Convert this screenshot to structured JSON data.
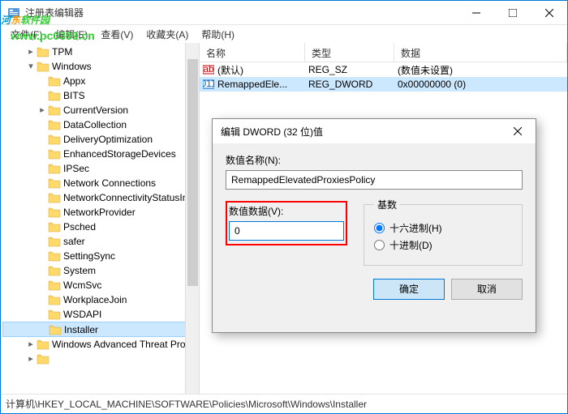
{
  "window": {
    "title": "注册表编辑器"
  },
  "menu": {
    "file": "文件(F)",
    "edit": "编辑(E)",
    "view": "查看(V)",
    "favorites": "收藏夹(A)",
    "help": "帮助(H)"
  },
  "tree": {
    "items": [
      {
        "indent": 2,
        "expand": ">",
        "label": "TPM"
      },
      {
        "indent": 2,
        "expand": "v",
        "label": "Windows"
      },
      {
        "indent": 3,
        "expand": " ",
        "label": "Appx"
      },
      {
        "indent": 3,
        "expand": " ",
        "label": "BITS"
      },
      {
        "indent": 3,
        "expand": ">",
        "label": "CurrentVersion"
      },
      {
        "indent": 3,
        "expand": " ",
        "label": "DataCollection"
      },
      {
        "indent": 3,
        "expand": " ",
        "label": "DeliveryOptimization"
      },
      {
        "indent": 3,
        "expand": " ",
        "label": "EnhancedStorageDevices"
      },
      {
        "indent": 3,
        "expand": " ",
        "label": "IPSec"
      },
      {
        "indent": 3,
        "expand": " ",
        "label": "Network Connections"
      },
      {
        "indent": 3,
        "expand": " ",
        "label": "NetworkConnectivityStatusInc"
      },
      {
        "indent": 3,
        "expand": " ",
        "label": "NetworkProvider"
      },
      {
        "indent": 3,
        "expand": " ",
        "label": "Psched"
      },
      {
        "indent": 3,
        "expand": " ",
        "label": "safer"
      },
      {
        "indent": 3,
        "expand": " ",
        "label": "SettingSync"
      },
      {
        "indent": 3,
        "expand": " ",
        "label": "System"
      },
      {
        "indent": 3,
        "expand": " ",
        "label": "WcmSvc"
      },
      {
        "indent": 3,
        "expand": " ",
        "label": "WorkplaceJoin"
      },
      {
        "indent": 3,
        "expand": " ",
        "label": "WSDAPI"
      },
      {
        "indent": 3,
        "expand": " ",
        "label": "Installer",
        "selected": true
      },
      {
        "indent": 2,
        "expand": ">",
        "label": "Windows Advanced Threat Prote"
      },
      {
        "indent": 2,
        "expand": ">",
        "label": ""
      }
    ]
  },
  "listview": {
    "cols": {
      "name": "名称",
      "type": "类型",
      "data": "数据"
    },
    "rows": [
      {
        "icon": "ab",
        "name": "(默认)",
        "type": "REG_SZ",
        "data": "(数值未设置)"
      },
      {
        "icon": "011",
        "name": "RemappedEle...",
        "type": "REG_DWORD",
        "data": "0x00000000 (0)",
        "selected": true
      }
    ]
  },
  "statusbar": {
    "path": "计算机\\HKEY_LOCAL_MACHINE\\SOFTWARE\\Policies\\Microsoft\\Windows\\Installer"
  },
  "dialog": {
    "title": "编辑 DWORD (32 位)值",
    "name_label": "数值名称(N):",
    "name_value": "RemappedElevatedProxiesPolicy",
    "data_label": "数值数据(V):",
    "data_value": "0",
    "base_label": "基数",
    "radio_hex": "十六进制(H)",
    "radio_dec": "十进制(D)",
    "ok": "确定",
    "cancel": "取消"
  },
  "watermark": {
    "text": "河东软件园",
    "url": "www.pc0359.cn"
  }
}
